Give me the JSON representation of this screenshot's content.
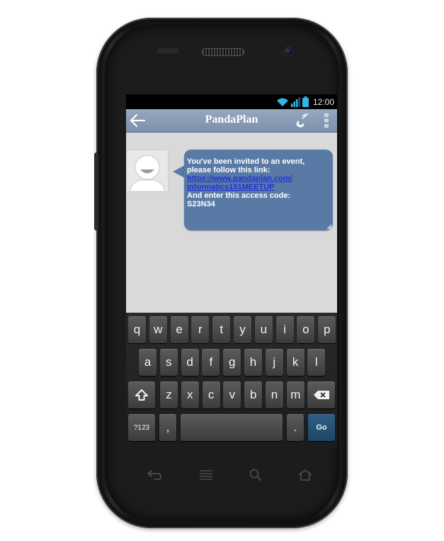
{
  "status_bar": {
    "time": "12:00"
  },
  "app": {
    "title": "PandaPlan"
  },
  "message": {
    "line1": "You've been invited to an event,",
    "line2": "please follow this link:",
    "link_line1": "https://www.pandaplan.com/",
    "link_line2": "informatics151MEETUP",
    "line3": "And enter this access code:",
    "code": "S23N34"
  },
  "keyboard": {
    "row1": [
      "q",
      "w",
      "e",
      "r",
      "t",
      "y",
      "u",
      "i",
      "o",
      "p"
    ],
    "row2": [
      "a",
      "s",
      "d",
      "f",
      "g",
      "h",
      "j",
      "k",
      "l"
    ],
    "row3": [
      "z",
      "x",
      "c",
      "v",
      "b",
      "n",
      "m"
    ],
    "symbols_label": "?123",
    "comma_label": ",",
    "period_label": ".",
    "go_label": "Go"
  },
  "colors": {
    "action_bar": "#8a9bb5",
    "bubble": "#5a7aa6",
    "link": "#1d33d6",
    "go_key": "#2a5a80"
  },
  "icons": [
    "wifi-icon",
    "signal-icon",
    "battery-icon",
    "back-arrow-icon",
    "phone-call-icon",
    "overflow-menu-icon",
    "avatar-icon",
    "shift-icon",
    "backspace-icon",
    "nav-back-icon",
    "nav-home-icon",
    "nav-search-icon",
    "nav-recent-icon"
  ]
}
